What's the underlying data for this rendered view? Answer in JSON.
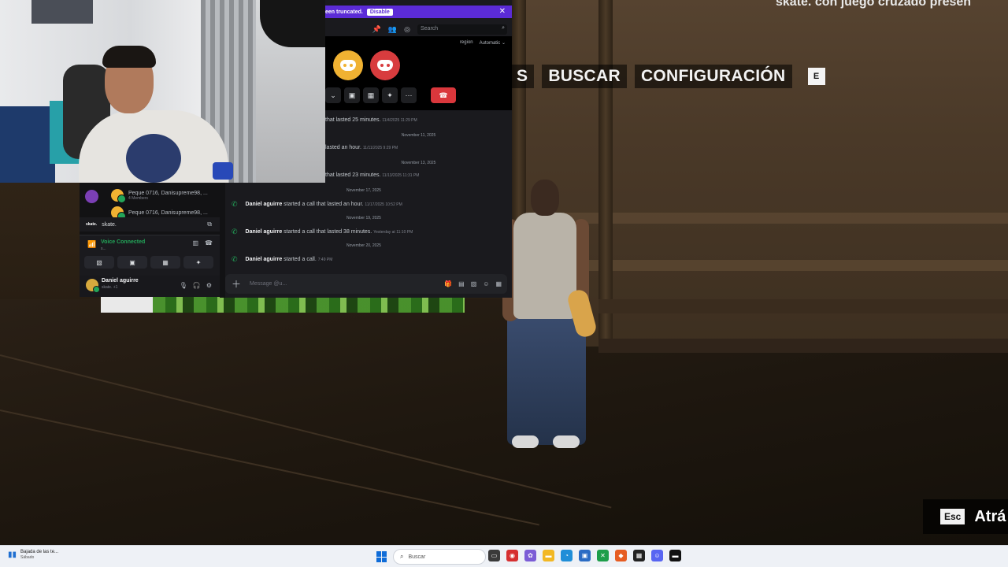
{
  "game": {
    "menu": [
      "S",
      "BUSCAR",
      "CONFIGURACIÓN"
    ],
    "menu_key": "E",
    "top_right_text": "skate. con juego cruzado presen",
    "back_key": "Esc",
    "back_label": "Atrá"
  },
  "discord": {
    "notice_text": "een truncated.",
    "notice_button": "Disable",
    "notice_close": "✕",
    "search_placeholder": "Search",
    "region_label": "region",
    "region_value": "Automatic ⌄",
    "messages_top": [
      {
        "text": "that lasted 25 minutes.",
        "time": "11/4/2025 11:29 PM"
      },
      {
        "text": "lasted an hour.",
        "time": "11/11/2025 9:29 PM"
      },
      {
        "text": "that lasted 23 minutes.",
        "time": "11/13/2025 11:31 PM"
      }
    ],
    "date_separators": [
      "November 11, 2025",
      "November 13, 2025",
      "November 17, 2025",
      "November 19, 2025",
      "November 20, 2025"
    ],
    "messages_lower": [
      {
        "author": "Daniel aguirre",
        "text": " started a call that lasted an hour.",
        "time": "11/17/2025 10:52 PM"
      },
      {
        "author": "Daniel aguirre",
        "text": " started a call that lasted 38 minutes.",
        "time": "Yesterday at 11:10 PM"
      },
      {
        "author": "Daniel aguirre",
        "text": " started a call.",
        "time": "7:49 PM"
      }
    ],
    "dm_entries": [
      {
        "name": "Peque 0716, Danisupreme98, ...",
        "sub": "4 Members"
      },
      {
        "name": "Peque 0716, Danisupreme98, ..."
      }
    ],
    "server_tag": "skate.",
    "server_name": "skate.",
    "voice_status": "Voice Connected",
    "voice_sub": "s...",
    "user_name": "Daniel aguirre",
    "user_status": "skate. +1",
    "message_placeholder": "Message @u..."
  },
  "taskbar": {
    "weather_text": "Bajada de las te...",
    "weather_sub": "Sábado",
    "search_label": "Buscar"
  }
}
